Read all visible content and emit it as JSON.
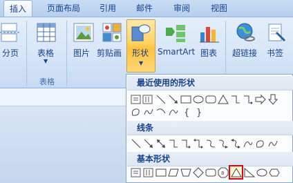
{
  "tabs": [
    {
      "label": "插入",
      "active": true
    },
    {
      "label": "页面布局",
      "active": false
    },
    {
      "label": "引用",
      "active": false
    },
    {
      "label": "邮件",
      "active": false
    },
    {
      "label": "审阅",
      "active": false
    },
    {
      "label": "视图",
      "active": false
    }
  ],
  "ribbon": {
    "page_break": "分页",
    "table": "表格",
    "table_group": "表格",
    "picture": "图片",
    "clipart": "剪贴画",
    "shapes": "形状",
    "smartart": "SmartArt",
    "chart": "图表",
    "hyperlink": "超链接",
    "bookmark": "书签"
  },
  "dropdown": {
    "recent_title": "最近使用的形状",
    "lines_title": "线条",
    "basic_title": "基本形状"
  },
  "colors": {
    "accent": "#15428b",
    "highlight": "#ffd264",
    "selected_border": "#e0001b"
  }
}
